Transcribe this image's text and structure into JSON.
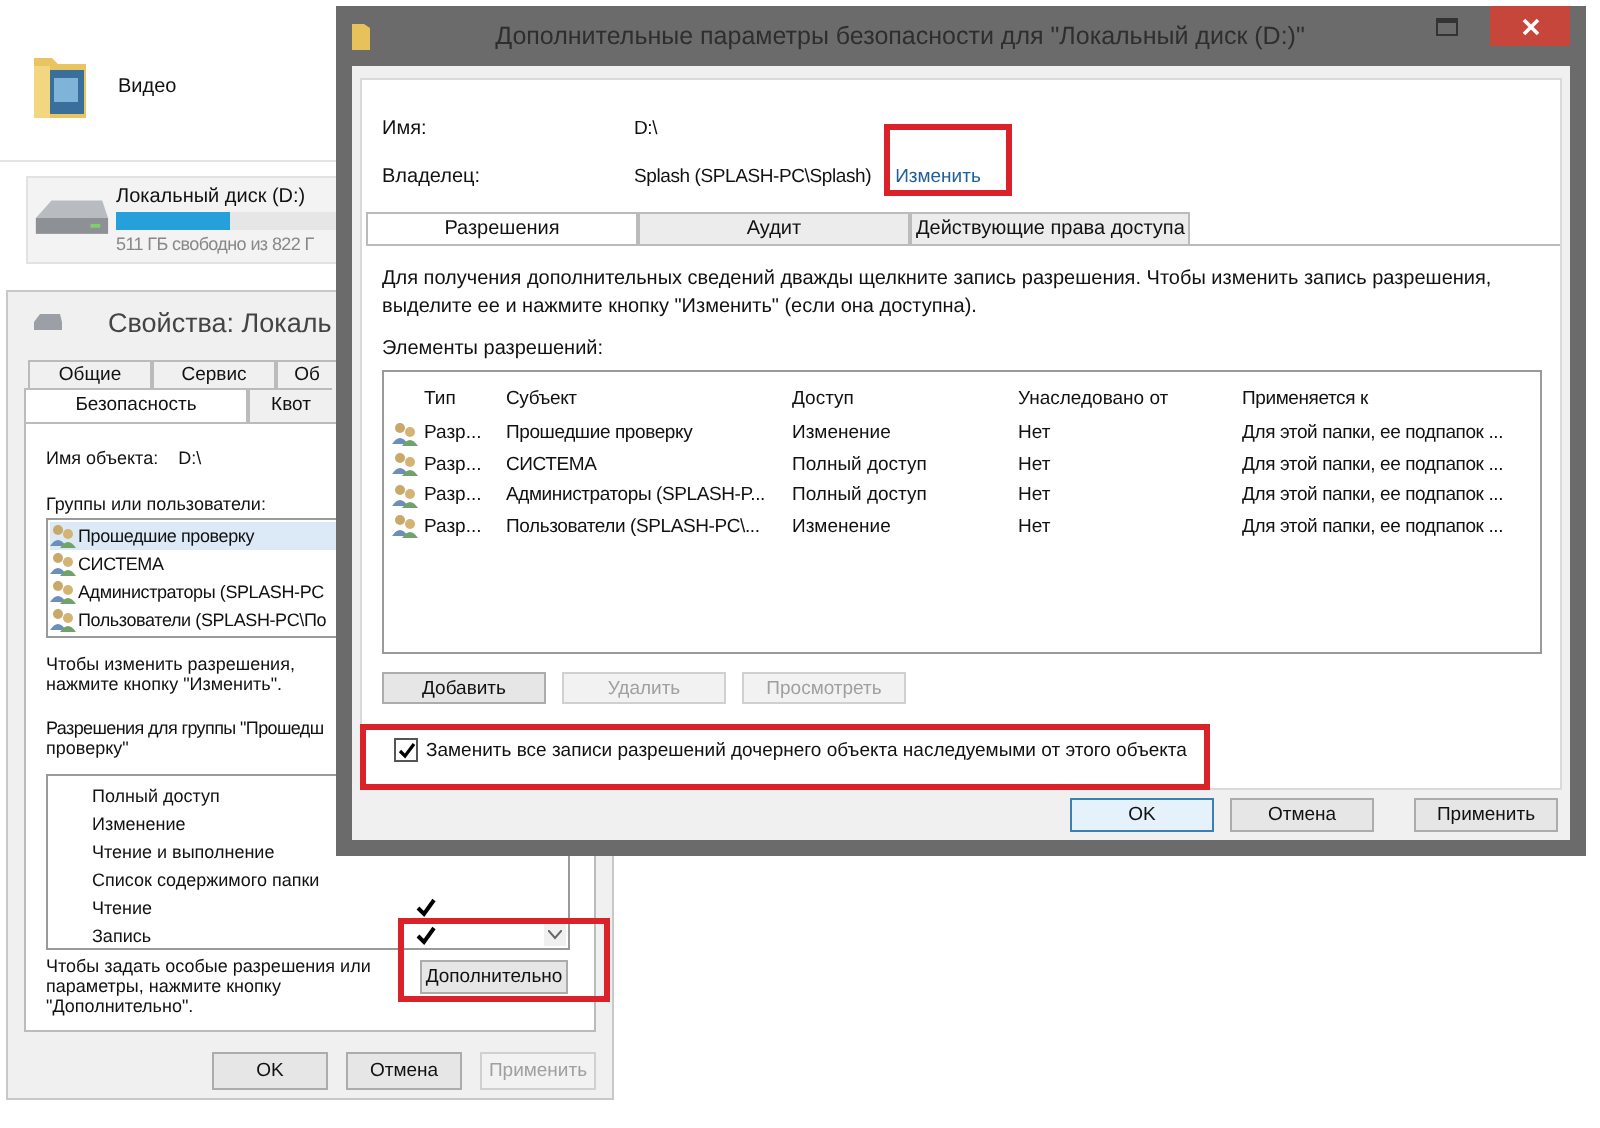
{
  "explorer": {
    "folder": {
      "label": "Видео"
    },
    "drive": {
      "label": "Локальный диск (D:)",
      "level": 0.52,
      "detail": "511 ГБ свободно из 822 Г"
    }
  },
  "properties": {
    "title": "Свойства: Локаль",
    "tab_rows": [
      [
        {
          "label": "Общие",
          "selected": false
        },
        {
          "label": "Сервис",
          "selected": false
        },
        {
          "label": "Об",
          "selected": false
        }
      ],
      [
        {
          "label": "Безопасность",
          "selected": true
        },
        {
          "label": "Квот",
          "selected": false
        }
      ]
    ],
    "object_label": "Имя объекта:",
    "object_value": "D:\\",
    "groups_label": "Группы или пользователи:",
    "groups": [
      {
        "name": "Прошедшие проверку",
        "selected": true
      },
      {
        "name": "СИСТЕМА",
        "selected": false
      },
      {
        "name": "Администраторы (SPLASH-PC",
        "selected": false
      },
      {
        "name": "Пользователи (SPLASH-PC\\По",
        "selected": false
      }
    ],
    "change_hint": "Чтобы изменить разрешения, нажмите кнопку \"Изменить\".",
    "perm_label": "Разрешения для группы \"Прошедш",
    "perm_label_cont": "проверку\"",
    "permissions": [
      {
        "name": "Полный доступ",
        "allow": false
      },
      {
        "name": "Изменение",
        "allow": false
      },
      {
        "name": "Чтение и выполнение",
        "allow": false
      },
      {
        "name": "Список содержимого папки",
        "allow": false
      },
      {
        "name": "Чтение",
        "allow": true
      },
      {
        "name": "Запись",
        "allow": true
      }
    ],
    "advanced_hint": "Чтобы задать особые разрешения или параметры, нажмите кнопку \"Дополнительно\".",
    "advanced_button": "Дополнительно",
    "buttons": [
      {
        "label": "OK",
        "disabled": false
      },
      {
        "label": "Отмена",
        "disabled": false
      },
      {
        "label": "Применить",
        "disabled": true
      }
    ]
  },
  "advanced": {
    "title": "Дополнительные параметры безопасности  для \"Локальный диск (D:)\"",
    "name_label": "Имя:",
    "name_value": "D:\\",
    "owner_label": "Владелец:",
    "owner_value": "Splash (SPLASH-PC\\Splash)",
    "owner_link": "Изменить",
    "tabs": [
      {
        "label": "Разрешения",
        "selected": true
      },
      {
        "label": "Аудит",
        "selected": false
      },
      {
        "label": "Действующие права доступа",
        "selected": false
      }
    ],
    "info": "Для получения дополнительных сведений дважды щелкните запись разрешения. Чтобы изменить запись разрешения, выделите ее и нажмите кнопку \"Изменить\" (если она доступна).",
    "entries_label": "Элементы разрешений:",
    "columns": [
      "Тип",
      "Субъект",
      "Доступ",
      "Унаследовано от",
      "Применяется к"
    ],
    "rows": [
      [
        "Разр...",
        "Прошедшие проверку",
        "Изменение",
        "Нет",
        "Для этой папки, ее подпапок ..."
      ],
      [
        "Разр...",
        "СИСТЕМА",
        "Полный доступ",
        "Нет",
        "Для этой папки, ее подпапок ..."
      ],
      [
        "Разр...",
        "Администраторы (SPLASH-P...",
        "Полный доступ",
        "Нет",
        "Для этой папки, ее подпапок ..."
      ],
      [
        "Разр...",
        "Пользователи (SPLASH-PC\\...",
        "Изменение",
        "Нет",
        "Для этой папки, ее подпапок ..."
      ]
    ],
    "actions": [
      {
        "label": "Добавить",
        "disabled": false
      },
      {
        "label": "Удалить",
        "disabled": true
      },
      {
        "label": "Просмотреть",
        "disabled": true
      }
    ],
    "replace_checkbox": {
      "label": "Заменить все записи разрешений дочернего объекта наследуемыми от этого объекта",
      "checked": true
    },
    "buttons": [
      {
        "label": "OK",
        "default": true
      },
      {
        "label": "Отмена",
        "default": false
      },
      {
        "label": "Применить",
        "default": false
      }
    ]
  }
}
